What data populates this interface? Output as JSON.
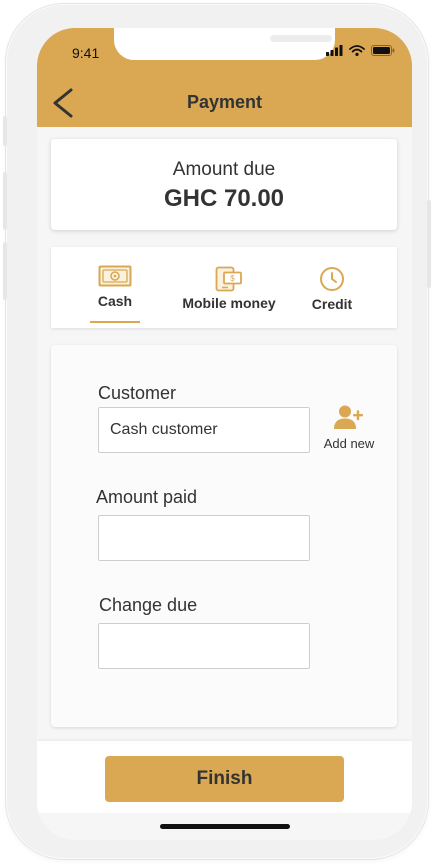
{
  "status_bar": {
    "time": "9:41",
    "icons": [
      "signal-icon",
      "wifi-icon",
      "battery-icon"
    ]
  },
  "header": {
    "title": "Payment",
    "back_icon": "chevron-left-icon"
  },
  "amount": {
    "label": "Amount due",
    "value": "GHC 70.00"
  },
  "payment_methods": [
    {
      "label": "Cash",
      "icon": "cash-icon",
      "selected": true
    },
    {
      "label": "Mobile money",
      "icon": "mobile-money-icon",
      "selected": false
    },
    {
      "label": "Credit",
      "icon": "clock-icon",
      "selected": false
    }
  ],
  "form": {
    "customer_label": "Customer",
    "customer_value": "Cash customer",
    "add_new_label": "Add new",
    "amount_paid_label": "Amount paid",
    "amount_paid_value": "",
    "change_due_label": "Change due",
    "change_due_value": ""
  },
  "footer": {
    "finish_label": "Finish"
  },
  "colors": {
    "accent": "#daa852",
    "text": "#333333",
    "screen_bg": "#f6f6f6"
  }
}
